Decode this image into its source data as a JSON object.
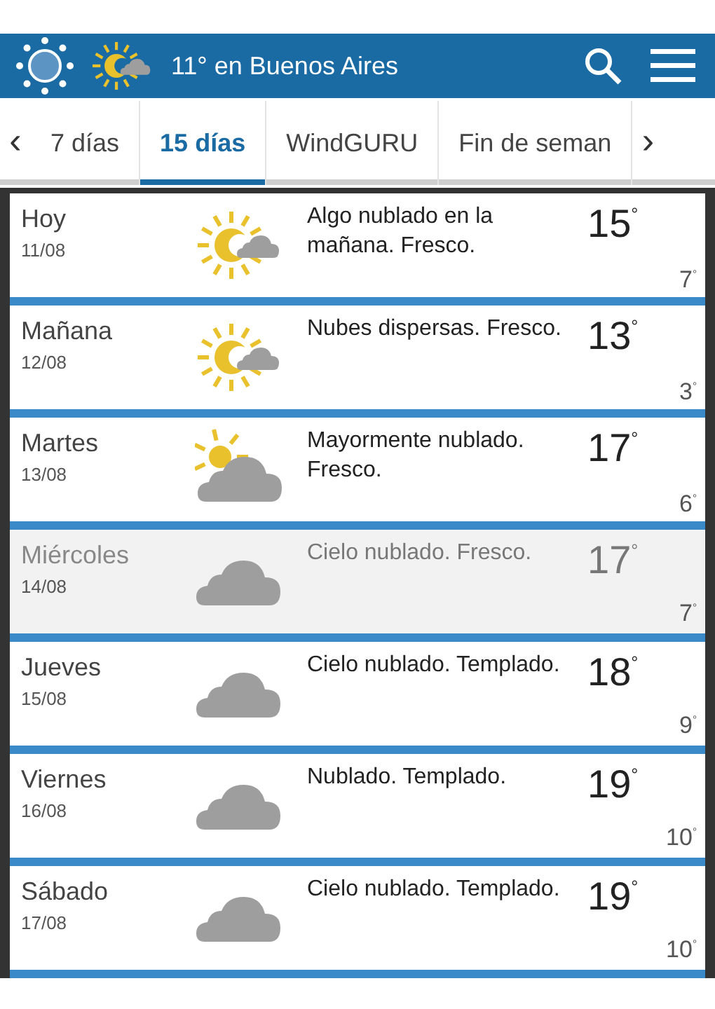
{
  "header": {
    "title": "11° en Buenos Aires"
  },
  "tabs": [
    {
      "label": "7 días",
      "selected": false
    },
    {
      "label": "15 días",
      "selected": true
    },
    {
      "label": "WindGURU",
      "selected": false
    },
    {
      "label": "Fin de seman",
      "selected": false
    }
  ],
  "tab_nav": {
    "prev": "‹",
    "next": "›"
  },
  "days": [
    {
      "day": "Hoy",
      "date": "11/08",
      "kind": "sun-cloud",
      "description": "Algo nublado en la mañana. Fresco.",
      "high": "15$^{°}$",
      "low": "7$^{°}$",
      "highlighted": false
    },
    {
      "day": "Mañana",
      "date": "12/08",
      "kind": "sun-cloud",
      "description": "Nubes dispersas. Fresco.",
      "high": "13$^{°}$",
      "low": "3$^{°}$",
      "highlighted": false
    },
    {
      "day": "Martes",
      "date": "13/08",
      "kind": "cloud-sun",
      "description": "Mayormente nublado. Fresco.",
      "high": "17$^{°}$",
      "low": "6$^{°}$",
      "highlighted": false
    },
    {
      "day": "Miércoles",
      "date": "14/08",
      "kind": "cloud",
      "description": "Cielo nublado. Fresco.",
      "high": "17$^{°}$",
      "low": "7$^{°}$",
      "highlighted": true
    },
    {
      "day": "Jueves",
      "date": "15/08",
      "kind": "cloud",
      "description": "Cielo nublado. Templado.",
      "high": "18$^{°}$",
      "low": "9$^{°}$",
      "highlighted": false
    },
    {
      "day": "Viernes",
      "date": "16/08",
      "kind": "cloud",
      "description": "Nublado. Templado.",
      "high": "19$^{°}$",
      "low": "10$^{°}$",
      "highlighted": false
    },
    {
      "day": "Sábado",
      "date": "17/08",
      "kind": "cloud",
      "description": "Cielo nublado. Templado.",
      "high": "19$^{°}$",
      "low": "10$^{°}$",
      "highlighted": false
    }
  ]
}
